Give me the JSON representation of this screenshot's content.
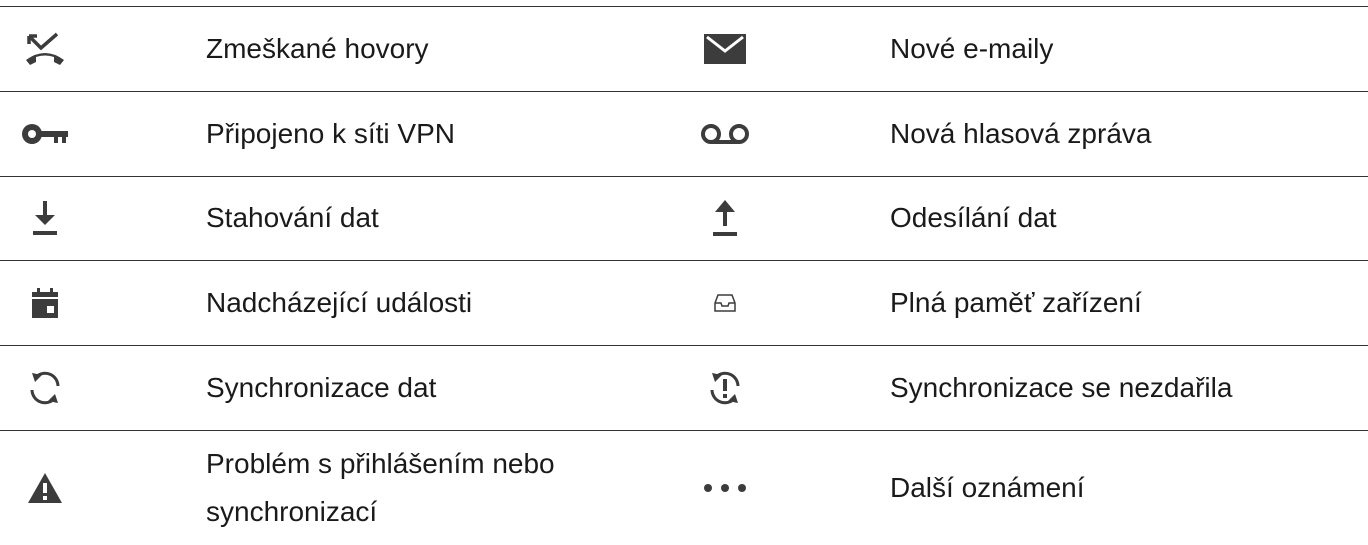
{
  "rows": [
    {
      "left": {
        "icon": "missed-call-icon",
        "label": "Zmeškané hovory"
      },
      "right": {
        "icon": "email-icon",
        "label": "Nové e-maily"
      }
    },
    {
      "left": {
        "icon": "vpn-key-icon",
        "label": "Připojeno k síti VPN"
      },
      "right": {
        "icon": "voicemail-icon",
        "label": "Nová hlasová zpráva"
      }
    },
    {
      "left": {
        "icon": "download-icon",
        "label": "Stahování dat"
      },
      "right": {
        "icon": "upload-icon",
        "label": "Odesílání dat"
      }
    },
    {
      "left": {
        "icon": "calendar-icon",
        "label": "Nadcházející události"
      },
      "right": {
        "icon": "storage-tray-icon",
        "label": "Plná paměť zařízení"
      }
    },
    {
      "left": {
        "icon": "sync-icon",
        "label": "Synchronizace dat"
      },
      "right": {
        "icon": "sync-failed-icon",
        "label": "Synchronizace se nezdařila"
      }
    },
    {
      "left": {
        "icon": "warning-icon",
        "label": "Problém s přihlášením nebo synchronizací"
      },
      "right": {
        "icon": "more-dots-icon",
        "label": "Další oznámení"
      }
    }
  ],
  "colors": {
    "icon": "#3c3c3c",
    "rule": "#333333",
    "text": "#1a1a1a"
  }
}
